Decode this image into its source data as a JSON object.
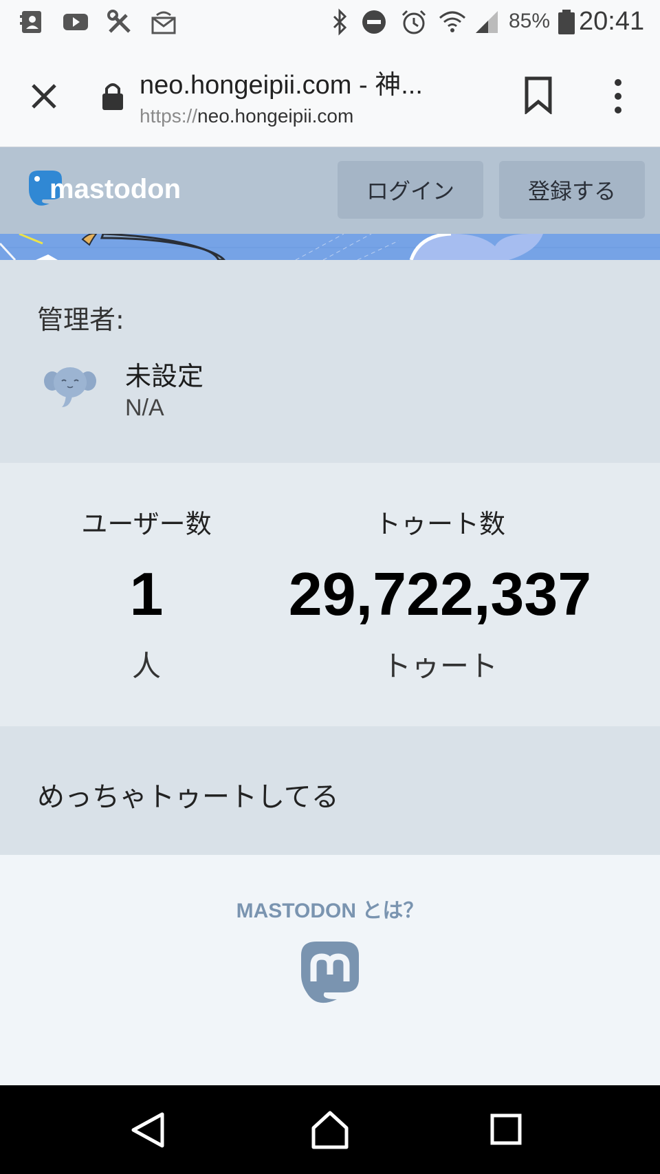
{
  "status_bar": {
    "icons": [
      "contacts-icon",
      "youtube-icon",
      "tools-icon",
      "inbox-icon",
      "bluetooth-icon",
      "do-not-disturb-icon",
      "alarm-icon",
      "wifi-icon",
      "signal-icon",
      "battery-icon"
    ],
    "battery_percent": "85%",
    "time": "20:41"
  },
  "browser": {
    "page_title": "neo.hongeipii.com - 神...",
    "url_scheme": "https://",
    "url_host": "neo.hongeipii.com"
  },
  "header": {
    "logo_text": "mastodon",
    "login_label": "ログイン",
    "signup_label": "登録する"
  },
  "admin": {
    "label": "管理者:",
    "display_name": "未設定",
    "handle": "N/A"
  },
  "stats": {
    "users": {
      "title": "ユーザー数",
      "value": "1",
      "unit": "人"
    },
    "toots": {
      "title": "トゥート数",
      "value": "29,722,337",
      "unit": "トゥート"
    }
  },
  "description": {
    "text": "めっちゃトゥートしてる"
  },
  "about": {
    "heading": "MASTODON とは？"
  },
  "colors": {
    "header_bg": "#b4c3d2",
    "section_bg": "#d9e1e8",
    "stats_bg": "#e5ebf0",
    "accent": "#7a94b0",
    "logo_blue": "#3088d4"
  }
}
